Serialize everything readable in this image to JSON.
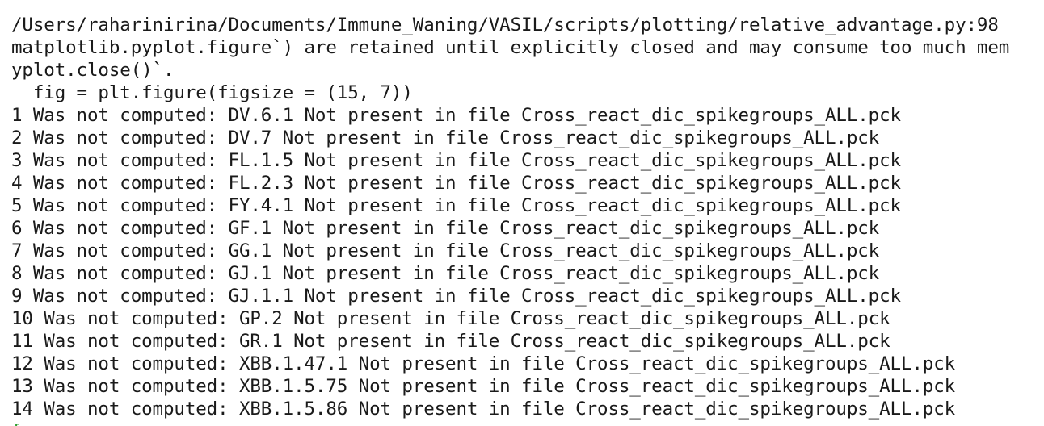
{
  "terminal": {
    "lines": [
      "/Users/raharinirina/Documents/Immune_Waning/VASIL/scripts/plotting/relative_advantage.py:98",
      "matplotlib.pyplot.figure`) are retained until explicitly closed and may consume too much mem",
      "yplot.close()`.",
      "  fig = plt.figure(figsize = (15, 7))",
      "1 Was not computed: DV.6.1 Not present in file Cross_react_dic_spikegroups_ALL.pck",
      "2 Was not computed: DV.7 Not present in file Cross_react_dic_spikegroups_ALL.pck",
      "3 Was not computed: FL.1.5 Not present in file Cross_react_dic_spikegroups_ALL.pck",
      "4 Was not computed: FL.2.3 Not present in file Cross_react_dic_spikegroups_ALL.pck",
      "5 Was not computed: FY.4.1 Not present in file Cross_react_dic_spikegroups_ALL.pck",
      "6 Was not computed: GF.1 Not present in file Cross_react_dic_spikegroups_ALL.pck",
      "7 Was not computed: GG.1 Not present in file Cross_react_dic_spikegroups_ALL.pck",
      "8 Was not computed: GJ.1 Not present in file Cross_react_dic_spikegroups_ALL.pck",
      "9 Was not computed: GJ.1.1 Not present in file Cross_react_dic_spikegroups_ALL.pck",
      "10 Was not computed: GP.2 Not present in file Cross_react_dic_spikegroups_ALL.pck",
      "11 Was not computed: GR.1 Not present in file Cross_react_dic_spikegroups_ALL.pck",
      "12 Was not computed: XBB.1.47.1 Not present in file Cross_react_dic_spikegroups_ALL.pck",
      "13 Was not computed: XBB.1.5.75 Not present in file Cross_react_dic_spikegroups_ALL.pck",
      "14 Was not computed: XBB.1.5.86 Not present in file Cross_react_dic_spikegroups_ALL.pck"
    ],
    "prompt_fragment": "[",
    "colors": {
      "background": "#ffffff",
      "text": "#1a1a1a",
      "prompt": "#2e9e2e"
    }
  }
}
